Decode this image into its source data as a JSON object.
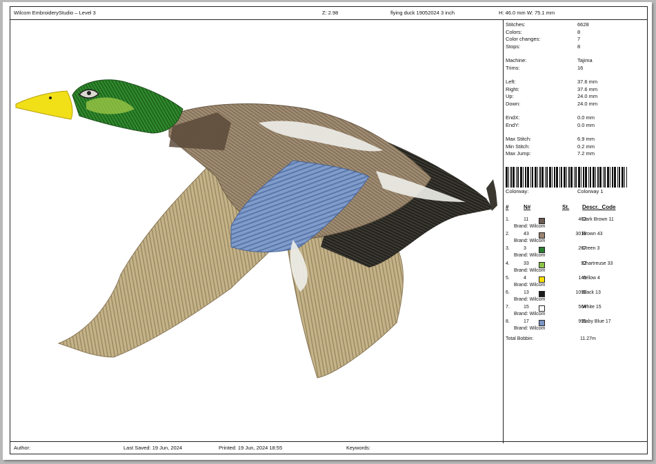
{
  "header": {
    "app_title": "Wilcom EmbroideryStudio – Level 3",
    "zoom": "Z: 2.98",
    "design_name": "flying duck 19052024 3 inch",
    "size": "H: 46.0 mm   W: 75.1 mm"
  },
  "stats": [
    {
      "label": "Stitches:",
      "value": "6628"
    },
    {
      "label": "Colors:",
      "value": "8"
    },
    {
      "label": "Color changes:",
      "value": "7"
    },
    {
      "label": "Stops:",
      "value": "8"
    },
    {
      "label": "Machine:",
      "value": "Tajima"
    },
    {
      "label": "Trims:",
      "value": "16"
    },
    {
      "label": "Left:",
      "value": "37.6 mm"
    },
    {
      "label": "Right:",
      "value": "37.6 mm"
    },
    {
      "label": "Up:",
      "value": "24.0 mm"
    },
    {
      "label": "Down:",
      "value": "24.0 mm"
    },
    {
      "label": "EndX:",
      "value": "0.0 mm"
    },
    {
      "label": "EndY:",
      "value": "0.0 mm"
    },
    {
      "label": "Max Stitch:",
      "value": "6.9 mm"
    },
    {
      "label": "Min Stitch:",
      "value": "0.2 mm"
    },
    {
      "label": "Max Jump:",
      "value": "7.2 mm"
    }
  ],
  "colorway": {
    "label": "Colorway:",
    "value": "Colorway 1"
  },
  "thread_table": {
    "headers": [
      "#",
      "N#",
      "St.",
      "Descr._Code"
    ],
    "rows": [
      {
        "index": "1.",
        "n": "11",
        "brand": "Brand: Wilcom",
        "color": "#6b5a52",
        "stitches": "462",
        "descr": "Dark Brown 11"
      },
      {
        "index": "2.",
        "n": "43",
        "brand": "Brand: Wilcom",
        "color": "#9a8470",
        "stitches": "3013",
        "descr": "Brown 43"
      },
      {
        "index": "3.",
        "n": "3",
        "brand": "Brand: Wilcom",
        "color": "#2e7d32",
        "stitches": "267",
        "descr": "Green 3"
      },
      {
        "index": "4.",
        "n": "33",
        "brand": "Brand: Wilcom",
        "color": "#8bc34a",
        "stitches": "92",
        "descr": "Chartreuse 33"
      },
      {
        "index": "5.",
        "n": "4",
        "brand": "Brand: Wilcom",
        "color": "#ffe000",
        "stitches": "145",
        "descr": "Yellow 4"
      },
      {
        "index": "6.",
        "n": "13",
        "brand": "Brand: Wilcom",
        "color": "#1a1a1a",
        "stitches": "1092",
        "descr": "Black 13"
      },
      {
        "index": "7.",
        "n": "15",
        "brand": "Brand: Wilcom",
        "color": "#ffffff",
        "stitches": "564",
        "descr": "White 15"
      },
      {
        "index": "8.",
        "n": "17",
        "brand": "Brand: Wilcom",
        "color": "#7b95c4",
        "stitches": "991",
        "descr": "Baby Blue 17"
      }
    ]
  },
  "bobbin": {
    "label": "Total Bobbin:",
    "value": "11.27m"
  },
  "footer": {
    "author": "Author:",
    "last_saved": "Last Saved: 19 Jun, 2024",
    "printed": "Printed: 19 Jun, 2024 18:55",
    "keywords": "Keywords:"
  }
}
